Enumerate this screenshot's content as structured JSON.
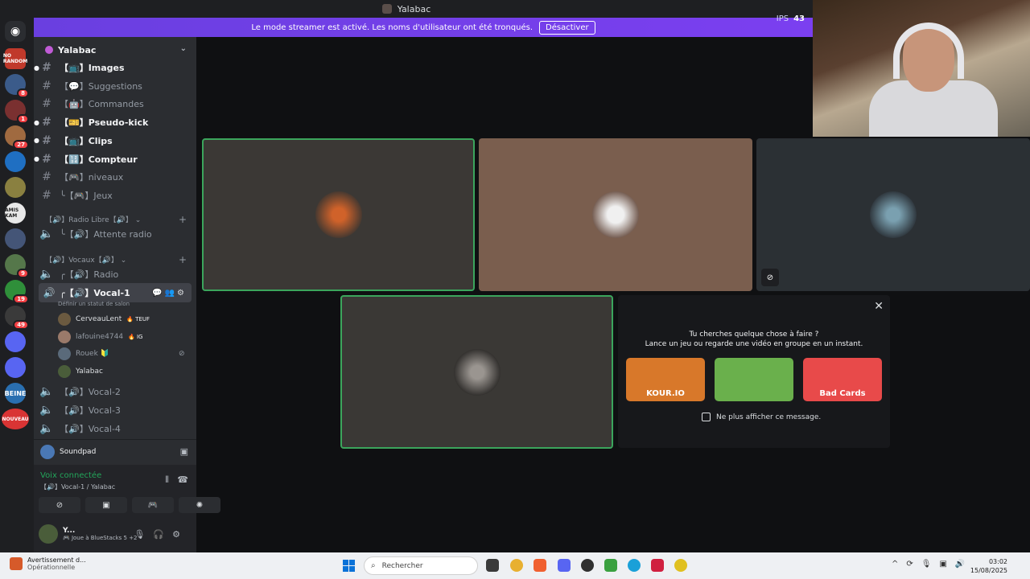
{
  "window": {
    "title": "Yalabac"
  },
  "banner": {
    "text": "Le mode streamer est activé. Les noms d'utilisateur ont été tronqués.",
    "button": "Désactiver",
    "fps_label": "IPS",
    "fps_value": "43"
  },
  "servers": [
    {
      "label": "NO RANDOM",
      "color": "#c0392b",
      "badge": ""
    },
    {
      "label": "",
      "color": "#3b5b8a",
      "badge": "8"
    },
    {
      "label": "",
      "color": "#7a3030",
      "badge": "1"
    },
    {
      "label": "",
      "color": "#a06a40",
      "badge": "27"
    },
    {
      "label": "",
      "color": "#1f6fc2",
      "badge": ""
    },
    {
      "label": "",
      "color": "#8a8040",
      "badge": ""
    },
    {
      "label": "AMIS KAM",
      "color": "#e8e8e8",
      "badge": ""
    },
    {
      "label": "",
      "color": "#445577",
      "badge": ""
    },
    {
      "label": "",
      "color": "#55774a",
      "badge": "9"
    },
    {
      "label": "",
      "color": "#2f8f3a",
      "badge": "19"
    },
    {
      "label": "",
      "color": "#3a3a3a",
      "badge": "49"
    },
    {
      "label": "",
      "color": "#5865f2",
      "badge": ""
    },
    {
      "label": "",
      "color": "#5865f2",
      "badge": ""
    },
    {
      "label": "BEINE",
      "color": "#2a6fb0",
      "badge": ""
    },
    {
      "label": "NOUVEAU",
      "color": "#d93434",
      "badge": ""
    }
  ],
  "guild": {
    "name": "Yalabac"
  },
  "channels": [
    {
      "prefix": "#",
      "name": "【📺】Images",
      "bold": true
    },
    {
      "prefix": "#",
      "name": "【💬】Suggestions",
      "bold": false
    },
    {
      "prefix": "#",
      "name": "【🤖】Commandes",
      "bold": false
    },
    {
      "prefix": "#",
      "name": "【🎫】Pseudo-kick",
      "bold": true
    },
    {
      "prefix": "#",
      "name": "【📺】Clips",
      "bold": true
    },
    {
      "prefix": "#",
      "name": "【🔢】Compteur",
      "bold": true
    },
    {
      "prefix": "#",
      "name": "【🎮】niveaux",
      "bold": false
    },
    {
      "prefix": "#",
      "name": "╰【🎮】Jeux",
      "bold": false
    }
  ],
  "categories": {
    "radio": "【🔊】Radio Libre【🔊】",
    "vocaux": "【🔊】Vocaux【🔊】"
  },
  "voice_channels": {
    "attente": "╰【🔊】Attente radio",
    "radio": "╭【🔊】Radio",
    "vocal1": "╭【🔊】Vocal-1",
    "vocal1_status": "Définir un statut de salon",
    "vocal2": "【🔊】Vocal-2",
    "vocal3": "【🔊】Vocal-3",
    "vocal4": "【🔊】Vocal-4"
  },
  "members": [
    {
      "name": "CerveauLent",
      "tag": "🔥 TEUF",
      "color": "#6b5a40"
    },
    {
      "name": "lafouine4744",
      "tag": "🔥 IG",
      "color": "#9a7a6a"
    },
    {
      "name": "Rouek 🔰",
      "tag": "",
      "color": "#5a6a7a"
    },
    {
      "name": "Yalabac",
      "tag": "",
      "color": "#4a5d3a"
    }
  ],
  "soundpad": {
    "label": "Soundpad"
  },
  "voice_panel": {
    "status": "Voix connectée",
    "channel": "【🔊】Vocal-1 / Yalabac"
  },
  "user_panel": {
    "name": "Y...",
    "status": "🎮 Joue à BlueStacks 5 +2"
  },
  "activity": {
    "line1": "Tu cherches quelque chose à faire ?",
    "line2": "Lance un jeu ou regarde une vidéo en groupe en un instant.",
    "games": [
      {
        "title": "KOUR.IO",
        "color": "#d8782a"
      },
      {
        "title": "",
        "color": "#6ab04c"
      },
      {
        "title": "Bad Cards",
        "color": "#e84a4a"
      }
    ],
    "dont_show": "Ne plus afficher ce message."
  },
  "taskbar": {
    "warning_title": "Avertissement d...",
    "warning_sub": "Opérationnelle",
    "search_placeholder": "Rechercher",
    "time": "03:02",
    "date": "15/08/2025"
  }
}
